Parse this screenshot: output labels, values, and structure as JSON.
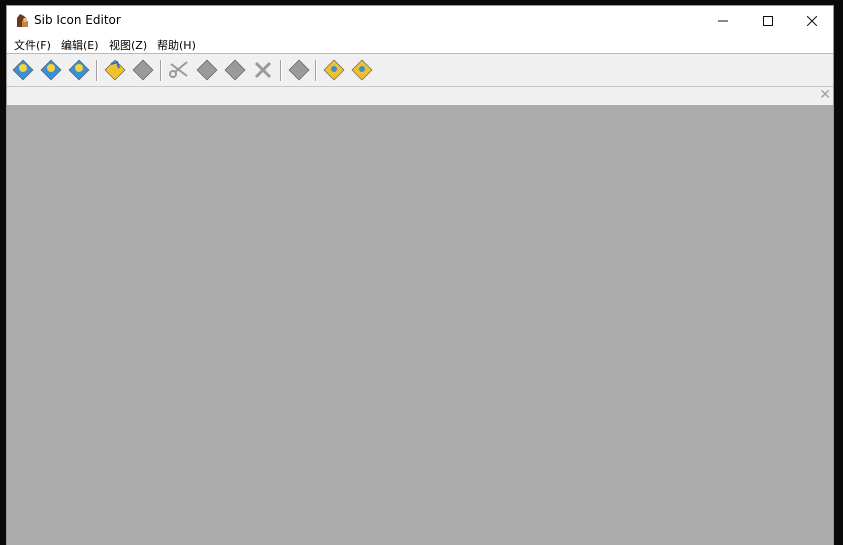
{
  "window": {
    "title": "Sib Icon Editor",
    "controls": [
      "minimize",
      "maximize",
      "close"
    ]
  },
  "menu": [
    {
      "label": "文件(F)"
    },
    {
      "label": "编辑(E)"
    },
    {
      "label": "视图(Z)"
    },
    {
      "label": "帮助(H)"
    }
  ],
  "toolbar": [
    {
      "icon": "new-icon",
      "enabled": true
    },
    {
      "icon": "open-icon",
      "enabled": true
    },
    {
      "icon": "save-icon",
      "enabled": true
    },
    {
      "icon": "import-icon",
      "enabled": true
    },
    {
      "icon": "export-icon",
      "enabled": false
    },
    {
      "icon": "cut-icon",
      "enabled": false
    },
    {
      "icon": "copy-icon",
      "enabled": false
    },
    {
      "icon": "paste-icon",
      "enabled": false
    },
    {
      "icon": "delete-icon",
      "enabled": false
    },
    {
      "icon": "properties-icon",
      "enabled": false
    },
    {
      "icon": "help-icon",
      "enabled": true
    },
    {
      "icon": "about-icon",
      "enabled": true
    }
  ],
  "colors": {
    "workspace": "#ababab",
    "toolbar": "#f0f0f0"
  }
}
